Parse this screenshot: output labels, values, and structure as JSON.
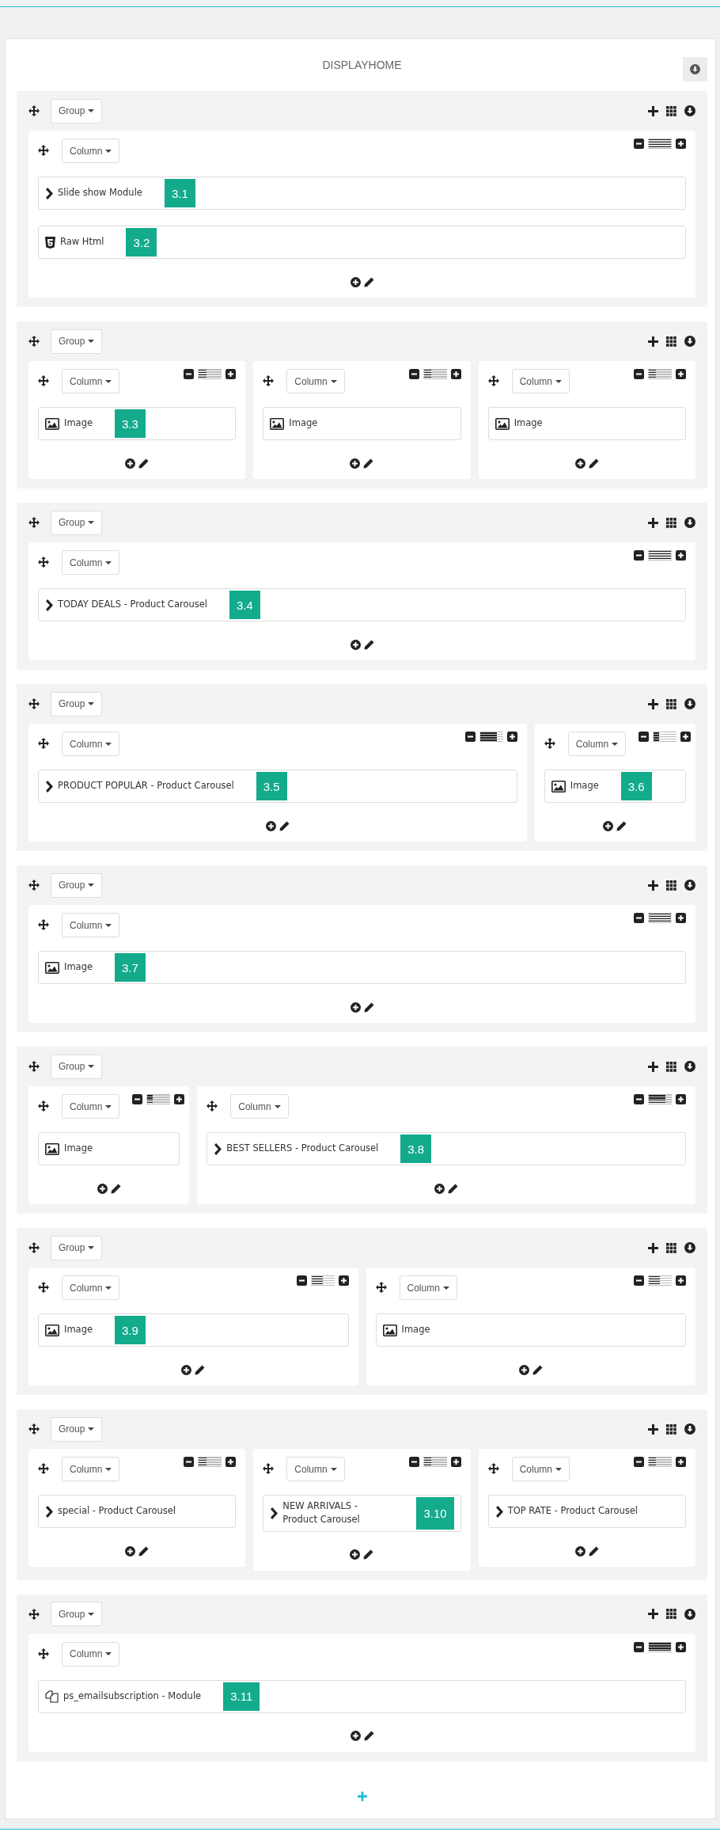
{
  "title": "DISPLAYHOME",
  "groups": [
    {
      "label": "Group",
      "columns": [
        {
          "label": "Column",
          "level": 1,
          "modules": [
            {
              "kind": "chevron",
              "label": "Slide show Module",
              "badge": "3.1"
            },
            {
              "kind": "html",
              "label": "Raw Html",
              "badge": "3.2"
            }
          ]
        }
      ]
    },
    {
      "label": "Group",
      "columns": [
        {
          "label": "Column",
          "level": 0.3333,
          "modules": [
            {
              "kind": "image",
              "label": "Image",
              "badge": "3.3"
            }
          ]
        },
        {
          "label": "Column",
          "level": 0.3333,
          "modules": [
            {
              "kind": "image",
              "label": "Image"
            }
          ]
        },
        {
          "label": "Column",
          "level": 0.3333,
          "modules": [
            {
              "kind": "image",
              "label": "Image"
            }
          ]
        }
      ]
    },
    {
      "label": "Group",
      "columns": [
        {
          "label": "Column",
          "level": 1,
          "modules": [
            {
              "kind": "chevron",
              "label": "TODAY DEALS - Product Carousel",
              "badge": "3.4"
            }
          ]
        }
      ]
    },
    {
      "label": "Group",
      "columns": [
        {
          "label": "Column",
          "level": 0.75,
          "modules": [
            {
              "kind": "chevron",
              "label": "PRODUCT POPULAR - Product Carousel",
              "badge": "3.5"
            }
          ]
        },
        {
          "label": "Column",
          "level": 0.25,
          "modules": [
            {
              "kind": "image",
              "label": "Image",
              "badge": "3.6"
            }
          ]
        }
      ]
    },
    {
      "label": "Group",
      "columns": [
        {
          "label": "Column",
          "level": 1,
          "modules": [
            {
              "kind": "image",
              "label": "Image",
              "badge": "3.7"
            }
          ]
        }
      ]
    },
    {
      "label": "Group",
      "columns": [
        {
          "label": "Column",
          "level": 0.25,
          "modules": [
            {
              "kind": "image",
              "label": "Image"
            }
          ]
        },
        {
          "label": "Column",
          "level": 0.75,
          "modules": [
            {
              "kind": "chevron",
              "label": "BEST SELLERS - Product Carousel",
              "badge": "3.8"
            }
          ]
        }
      ]
    },
    {
      "label": "Group",
      "columns": [
        {
          "label": "Column",
          "level": 0.5,
          "modules": [
            {
              "kind": "image",
              "label": "Image",
              "badge": "3.9"
            }
          ]
        },
        {
          "label": "Column",
          "level": 0.5,
          "modules": [
            {
              "kind": "image",
              "label": "Image"
            }
          ]
        }
      ]
    },
    {
      "label": "Group",
      "columns": [
        {
          "label": "Column",
          "level": 0.3333,
          "modules": [
            {
              "kind": "chevron",
              "label": "special - Product Carousel"
            }
          ]
        },
        {
          "label": "Column",
          "level": 0.3333,
          "modules": [
            {
              "kind": "chevron",
              "label": "NEW ARRIVALS - Product Carousel",
              "badge": "3.10"
            }
          ]
        },
        {
          "label": "Column",
          "level": 0.3333,
          "modules": [
            {
              "kind": "chevron",
              "label": "TOP RATE - Product Carousel"
            }
          ]
        }
      ]
    },
    {
      "label": "Group",
      "columns": [
        {
          "label": "Column",
          "level": 1,
          "modules": [
            {
              "kind": "copy",
              "label": "ps_emailsubscription - Module",
              "badge": "3.11"
            }
          ]
        }
      ]
    }
  ]
}
